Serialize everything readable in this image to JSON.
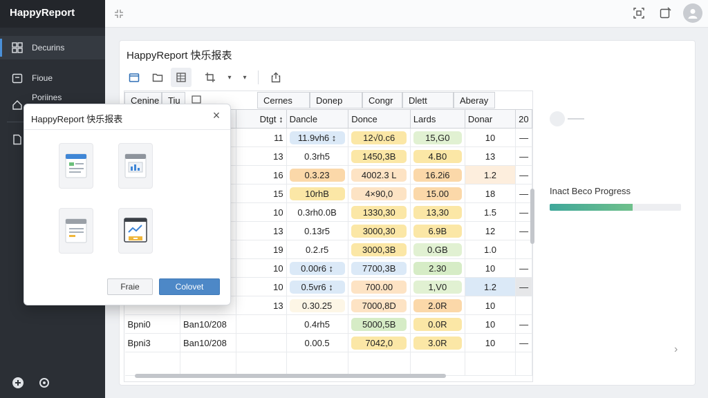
{
  "app": {
    "title": "HappyReport"
  },
  "sidebar": {
    "items": [
      {
        "label": "Decurins",
        "icon": "grid-icon",
        "active": true
      },
      {
        "label": "Fioue",
        "icon": "calendar-icon"
      },
      {
        "label": "Poriines",
        "icon": "home-icon"
      },
      {
        "label": "",
        "icon": "document-icon"
      }
    ]
  },
  "panel": {
    "title": "HappyReport 快乐报表"
  },
  "grid": {
    "group_headers": [
      "Cenine",
      "Tiu",
      "",
      "Cernes",
      "Donep",
      "Congr",
      "Dlett",
      "Aberay"
    ],
    "headers": [
      "",
      "",
      "Dtgt ↕",
      "Dancle",
      "Donce",
      "Lards",
      "Donar",
      "20"
    ],
    "rows": [
      [
        "",
        "",
        "11",
        "11.9vh6 ↕",
        "12√0.c6",
        "15,G0",
        "10",
        "—"
      ],
      [
        "",
        "",
        "13",
        "0.3rh5",
        "1450,3B",
        "4.B0",
        "13",
        "—"
      ],
      [
        "",
        "",
        "16",
        "0.3.23",
        "4002.3 L",
        "16.2i6",
        "1.2",
        "—"
      ],
      [
        "",
        "",
        "15",
        "10rhB",
        "4×90,0",
        "15.00",
        "18",
        "—"
      ],
      [
        "",
        "",
        "10",
        "0.3rh0.0B",
        "1330,30",
        "13,30",
        "1.5",
        "—"
      ],
      [
        "",
        "",
        "13",
        "0.13r5",
        "3000,30",
        "6.9B",
        "12",
        "—"
      ],
      [
        "",
        "",
        "19",
        "0.2.r5",
        "3000,3B",
        "0.GB",
        "1.0",
        ""
      ],
      [
        "",
        "",
        "10",
        "0.00r6 ↕",
        "7700,3B",
        "2.30",
        "10",
        "—"
      ],
      [
        "",
        "",
        "10",
        "0.5vr6 ↕",
        "700.00",
        "1,V0",
        "1.2",
        "—"
      ],
      [
        "",
        "",
        "13",
        "0.30.25",
        "7000,8D",
        "2.0R",
        "10",
        ""
      ],
      [
        "Bpni0",
        "Ban10/208",
        "",
        "0.4rh5",
        "5000,5B",
        "0.0R",
        "10",
        "—"
      ],
      [
        "Bpni3",
        "Ban10/208",
        "",
        "0.00.5",
        "7042,0",
        "3.0R",
        "10",
        "—"
      ]
    ]
  },
  "progress": {
    "label": "Inact Beco Progress",
    "value": 0.63
  },
  "dialog": {
    "title": "HappyReport 快乐报表",
    "buttons": {
      "secondary": "Fraie",
      "primary": "Colovet"
    }
  }
}
